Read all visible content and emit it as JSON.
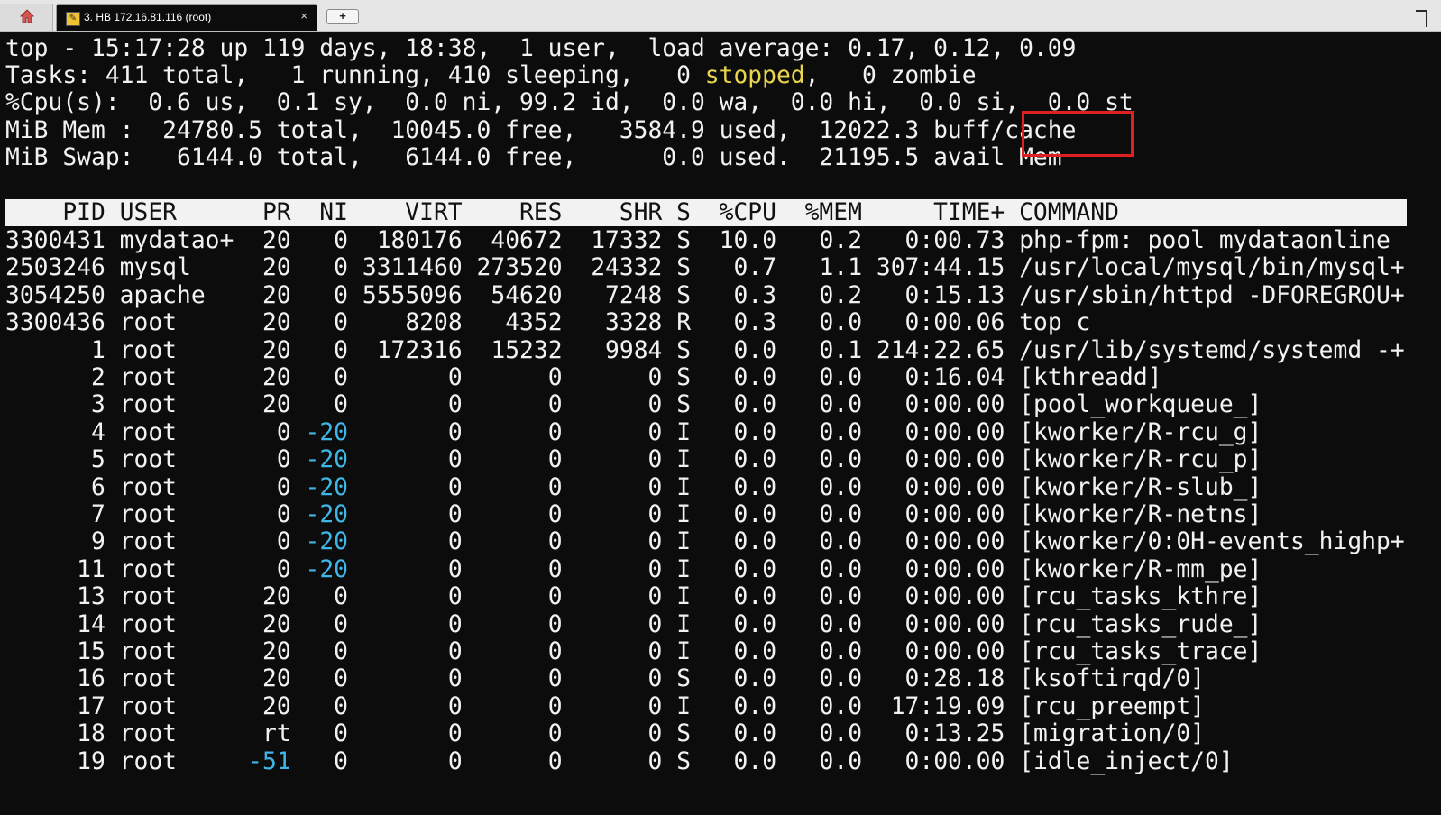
{
  "tabbar": {
    "home_icon": "home-icon",
    "tab_title": "3. HB 172.16.81.116 (root)",
    "tab_close": "×",
    "new_tab": "+"
  },
  "summary": {
    "line1": "top - 15:17:28 up 119 days, 18:38,  1 user,  load average: 0.17, 0.12, 0.09",
    "line2_a": "Tasks: 411 total,   1 running, 410 sleeping,   0 ",
    "line2_stopped": "stopped",
    "line2_b": ",   0 zombie",
    "line3": "%Cpu(s):  0.6 us,  0.1 sy,  0.0 ni, 99.2 id,  0.0 wa,  0.0 hi,  0.0 si,  0.0 st",
    "line4": "MiB Mem :  24780.5 total,  10045.0 free,   3584.9 used,  12022.3 buff/cache",
    "line5": "MiB Swap:   6144.0 total,   6144.0 free,      0.0 used.  21195.5 avail Mem"
  },
  "table": {
    "header": "    PID USER      PR  NI    VIRT    RES    SHR S  %CPU  %MEM     TIME+ COMMAND",
    "rows": [
      {
        "pid": "3300431",
        "user": "mydatao+",
        "pr": "20",
        "ni": "0",
        "virt": "180176",
        "res": "40672",
        "shr": "17332",
        "s": "S",
        "cpu": "10.0",
        "mem": "0.2",
        "time": "0:00.73",
        "cmd": "php-fpm: pool mydataonline"
      },
      {
        "pid": "2503246",
        "user": "mysql",
        "pr": "20",
        "ni": "0",
        "virt": "3311460",
        "res": "273520",
        "shr": "24332",
        "s": "S",
        "cpu": "0.7",
        "mem": "1.1",
        "time": "307:44.15",
        "cmd": "/usr/local/mysql/bin/mysql+"
      },
      {
        "pid": "3054250",
        "user": "apache",
        "pr": "20",
        "ni": "0",
        "virt": "5555096",
        "res": "54620",
        "shr": "7248",
        "s": "S",
        "cpu": "0.3",
        "mem": "0.2",
        "time": "0:15.13",
        "cmd": "/usr/sbin/httpd -DFOREGROU+"
      },
      {
        "pid": "3300436",
        "user": "root",
        "pr": "20",
        "ni": "0",
        "virt": "8208",
        "res": "4352",
        "shr": "3328",
        "s": "R",
        "cpu": "0.3",
        "mem": "0.0",
        "time": "0:00.06",
        "cmd": "top c"
      },
      {
        "pid": "1",
        "user": "root",
        "pr": "20",
        "ni": "0",
        "virt": "172316",
        "res": "15232",
        "shr": "9984",
        "s": "S",
        "cpu": "0.0",
        "mem": "0.1",
        "time": "214:22.65",
        "cmd": "/usr/lib/systemd/systemd -+"
      },
      {
        "pid": "2",
        "user": "root",
        "pr": "20",
        "ni": "0",
        "virt": "0",
        "res": "0",
        "shr": "0",
        "s": "S",
        "cpu": "0.0",
        "mem": "0.0",
        "time": "0:16.04",
        "cmd": "[kthreadd]"
      },
      {
        "pid": "3",
        "user": "root",
        "pr": "20",
        "ni": "0",
        "virt": "0",
        "res": "0",
        "shr": "0",
        "s": "S",
        "cpu": "0.0",
        "mem": "0.0",
        "time": "0:00.00",
        "cmd": "[pool_workqueue_]"
      },
      {
        "pid": "4",
        "user": "root",
        "pr": "0",
        "ni": "-20",
        "virt": "0",
        "res": "0",
        "shr": "0",
        "s": "I",
        "cpu": "0.0",
        "mem": "0.0",
        "time": "0:00.00",
        "cmd": "[kworker/R-rcu_g]"
      },
      {
        "pid": "5",
        "user": "root",
        "pr": "0",
        "ni": "-20",
        "virt": "0",
        "res": "0",
        "shr": "0",
        "s": "I",
        "cpu": "0.0",
        "mem": "0.0",
        "time": "0:00.00",
        "cmd": "[kworker/R-rcu_p]"
      },
      {
        "pid": "6",
        "user": "root",
        "pr": "0",
        "ni": "-20",
        "virt": "0",
        "res": "0",
        "shr": "0",
        "s": "I",
        "cpu": "0.0",
        "mem": "0.0",
        "time": "0:00.00",
        "cmd": "[kworker/R-slub_]"
      },
      {
        "pid": "7",
        "user": "root",
        "pr": "0",
        "ni": "-20",
        "virt": "0",
        "res": "0",
        "shr": "0",
        "s": "I",
        "cpu": "0.0",
        "mem": "0.0",
        "time": "0:00.00",
        "cmd": "[kworker/R-netns]"
      },
      {
        "pid": "9",
        "user": "root",
        "pr": "0",
        "ni": "-20",
        "virt": "0",
        "res": "0",
        "shr": "0",
        "s": "I",
        "cpu": "0.0",
        "mem": "0.0",
        "time": "0:00.00",
        "cmd": "[kworker/0:0H-events_highp+"
      },
      {
        "pid": "11",
        "user": "root",
        "pr": "0",
        "ni": "-20",
        "virt": "0",
        "res": "0",
        "shr": "0",
        "s": "I",
        "cpu": "0.0",
        "mem": "0.0",
        "time": "0:00.00",
        "cmd": "[kworker/R-mm_pe]"
      },
      {
        "pid": "13",
        "user": "root",
        "pr": "20",
        "ni": "0",
        "virt": "0",
        "res": "0",
        "shr": "0",
        "s": "I",
        "cpu": "0.0",
        "mem": "0.0",
        "time": "0:00.00",
        "cmd": "[rcu_tasks_kthre]"
      },
      {
        "pid": "14",
        "user": "root",
        "pr": "20",
        "ni": "0",
        "virt": "0",
        "res": "0",
        "shr": "0",
        "s": "I",
        "cpu": "0.0",
        "mem": "0.0",
        "time": "0:00.00",
        "cmd": "[rcu_tasks_rude_]"
      },
      {
        "pid": "15",
        "user": "root",
        "pr": "20",
        "ni": "0",
        "virt": "0",
        "res": "0",
        "shr": "0",
        "s": "I",
        "cpu": "0.0",
        "mem": "0.0",
        "time": "0:00.00",
        "cmd": "[rcu_tasks_trace]"
      },
      {
        "pid": "16",
        "user": "root",
        "pr": "20",
        "ni": "0",
        "virt": "0",
        "res": "0",
        "shr": "0",
        "s": "S",
        "cpu": "0.0",
        "mem": "0.0",
        "time": "0:28.18",
        "cmd": "[ksoftirqd/0]"
      },
      {
        "pid": "17",
        "user": "root",
        "pr": "20",
        "ni": "0",
        "virt": "0",
        "res": "0",
        "shr": "0",
        "s": "I",
        "cpu": "0.0",
        "mem": "0.0",
        "time": "17:19.09",
        "cmd": "[rcu_preempt]"
      },
      {
        "pid": "18",
        "user": "root",
        "pr": "rt",
        "ni": "0",
        "virt": "0",
        "res": "0",
        "shr": "0",
        "s": "S",
        "cpu": "0.0",
        "mem": "0.0",
        "time": "0:13.25",
        "cmd": "[migration/0]"
      },
      {
        "pid": "19",
        "user": "root",
        "pr": "-51",
        "ni": "0",
        "virt": "0",
        "res": "0",
        "shr": "0",
        "s": "S",
        "cpu": "0.0",
        "mem": "0.0",
        "time": "0:00.00",
        "cmd": "[idle_inject/0]"
      }
    ]
  },
  "colors": {
    "background": "#0c0c0c",
    "text": "#f2f2f2",
    "stopped": "#e8d44d",
    "negative_priority": "#3fb6e6",
    "highlight_box": "#e02020"
  }
}
